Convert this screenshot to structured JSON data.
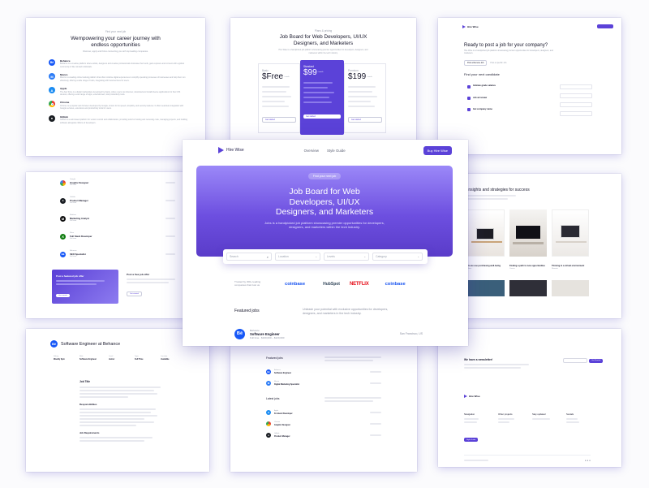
{
  "mission": {
    "tag": "Find your next job",
    "title": "Wempowering your career journey with endless opportunities",
    "subtitle": "Discover, apply and thrive connecting you with top leading companies.",
    "companies": [
      {
        "name": "Behance",
        "icon": "be-icon",
        "color": "#1758f7",
        "desc": "Behance is a creative platform where artists, designers and creative professionals showcase their work, gain exposure and connect with a global community of like minded individuals."
      },
      {
        "name": "Monzo",
        "icon": "monzo-icon",
        "color": "#2c7cf6",
        "desc": "Monzo is a leading online banking platform that offers intuitive digital experiences to simplify operating processes of businesses and help them run effectively, offering a wide range of tools, integrating with local services for users."
      },
      {
        "name": "Apple",
        "icon": "appstore-icon",
        "color": "#1b8cf2",
        "desc": "The App Store is a digital marketplace developed by Apple, where users can discover, download and install diverse applications for their iOS devices, offering a vast range of apps, entertainment, and productivity tools."
      },
      {
        "name": "Chrome",
        "icon": "chrome-icon",
        "color": "#e94335",
        "desc": "Chrome is a popular web browser developed by Google, known for its speed, simplicity, and security features. It offers seamless integration with Google services, extensions and productivity tools for users."
      },
      {
        "name": "GitHub",
        "icon": "github-icon",
        "color": "#1b1f24",
        "desc": "GitHub is a web-based platform for version control and collaboration, providing tools for hosting and reviewing code, managing projects, and building software alongside millions of developers."
      }
    ]
  },
  "pricing": {
    "tag": "Plans & pricing",
    "title": "Job Board for Web Developers, UI/UX Designers, and Marketers",
    "subtitle": "Hire Wise is a handpicked job platform showcasing premier opportunities for developers, designers, and marketers within the tech industry.",
    "plans": [
      {
        "name": "Basic",
        "price": "$Free",
        "period": "/ month",
        "button": "Get started"
      },
      {
        "name": "Standard",
        "price": "$99",
        "period": "/ month",
        "button": "Get started"
      },
      {
        "name": "Premium",
        "price": "$199",
        "period": "/ month",
        "button": "Get started"
      }
    ]
  },
  "post": {
    "brand": "Hire Wise",
    "title": "Ready to post a job for your company?",
    "sub": "Hire Wise is a handpicked job platform showcasing premier opportunities for developers, designers, and marketers.",
    "tabs": [
      "Post a Remote Job",
      "Post a specific Job"
    ],
    "find_title": "Find your next candidate",
    "features": [
      "Indicate grade salaries",
      "Job ad review",
      "Get company name"
    ]
  },
  "jobs": {
    "items": [
      {
        "company": "Google",
        "title": "Graphic Designer",
        "time": "Full time"
      },
      {
        "company": "GitHub",
        "title": "Product Manager",
        "time": "Full time"
      },
      {
        "company": "Medium",
        "title": "Marketing Analyst",
        "time": "Full time"
      },
      {
        "company": "Xbox",
        "title": "Full Stack Developer",
        "time": "Full time"
      },
      {
        "company": "Behance",
        "title": "SEO Specialist",
        "time": "Full time"
      }
    ],
    "cta1_title": "Post a featured job offer",
    "cta1_button": "Get started",
    "cta2_title": "Post a free job offer",
    "cta2_button": "Get started"
  },
  "blog": {
    "title": "Insights and strategies for success",
    "cards": [
      {
        "title": "Do we use purchasing well-being",
        "tag": "Ideas"
      },
      {
        "title": "Finding a path to new opportunities",
        "tag": "Career"
      },
      {
        "title": "Thriving in a virtual environment",
        "tag": "Remote"
      }
    ]
  },
  "main": {
    "brand": "Hire Wise",
    "nav": [
      "Overview",
      "Style Guide"
    ],
    "buy": "Buy Hire Wise",
    "hero_tag": "Find your next job",
    "hero_title": "Job Board for Web Developers, UI/UX Designers, and Marketers",
    "hero_sub": "Jobs is a handpicked job platform showcasing premier opportunities for developers, designers, and marketers within the tech industry.",
    "search": {
      "placeholder": "Search",
      "location": "Location",
      "levels": "Levels",
      "category": "Category"
    },
    "trusted": "Trusted by 300+ leading companies that trust us",
    "logos": [
      "coinbase",
      "HubSpot",
      "NETFLIX",
      "coinbase"
    ],
    "featured_title": "Featured jobs",
    "featured_desc": "Unleash your potential with exclusive opportunities for developers, designers, and marketers in the tech industry.",
    "job": {
      "company": "Behance",
      "title": "Software Engineer",
      "meta": "Full time  ·  $100,000 – $120,000",
      "location": "San Francisco, US"
    }
  },
  "detail": {
    "title": "Software Engineer at Behance",
    "cols": [
      {
        "label": "Salary",
        "value": "Weekly 3pm"
      },
      {
        "label": "Role",
        "value": "Software Engineer"
      },
      {
        "label": "Level",
        "value": "Junior"
      },
      {
        "label": "Type",
        "value": "Full Time"
      },
      {
        "label": "Location",
        "value": "Available"
      }
    ],
    "job_title": "Job Title",
    "resp": "Responsibilities",
    "req": "Job Requirements"
  },
  "listing": {
    "featured": "Featured jobs",
    "latest": "Latest jobs",
    "featured_items": [
      {
        "company": "Behance",
        "title": "Software Engineer"
      },
      {
        "company": "Monzo",
        "title": "Digital Marketing Specialist"
      }
    ],
    "latest_items": [
      {
        "company": "Apple",
        "title": "Frontend Developer"
      },
      {
        "company": "Chrome",
        "title": "Graphic Designer"
      },
      {
        "company": "GitHub",
        "title": "Product Manager"
      }
    ]
  },
  "footer": {
    "news_title": "We have a newsletter!",
    "subscribe": "Get Started",
    "brand": "Hire Wise",
    "cols": [
      "Navigation",
      "Other projects",
      "Stay updated",
      "Socials"
    ],
    "style_btn": "Style Guide"
  }
}
